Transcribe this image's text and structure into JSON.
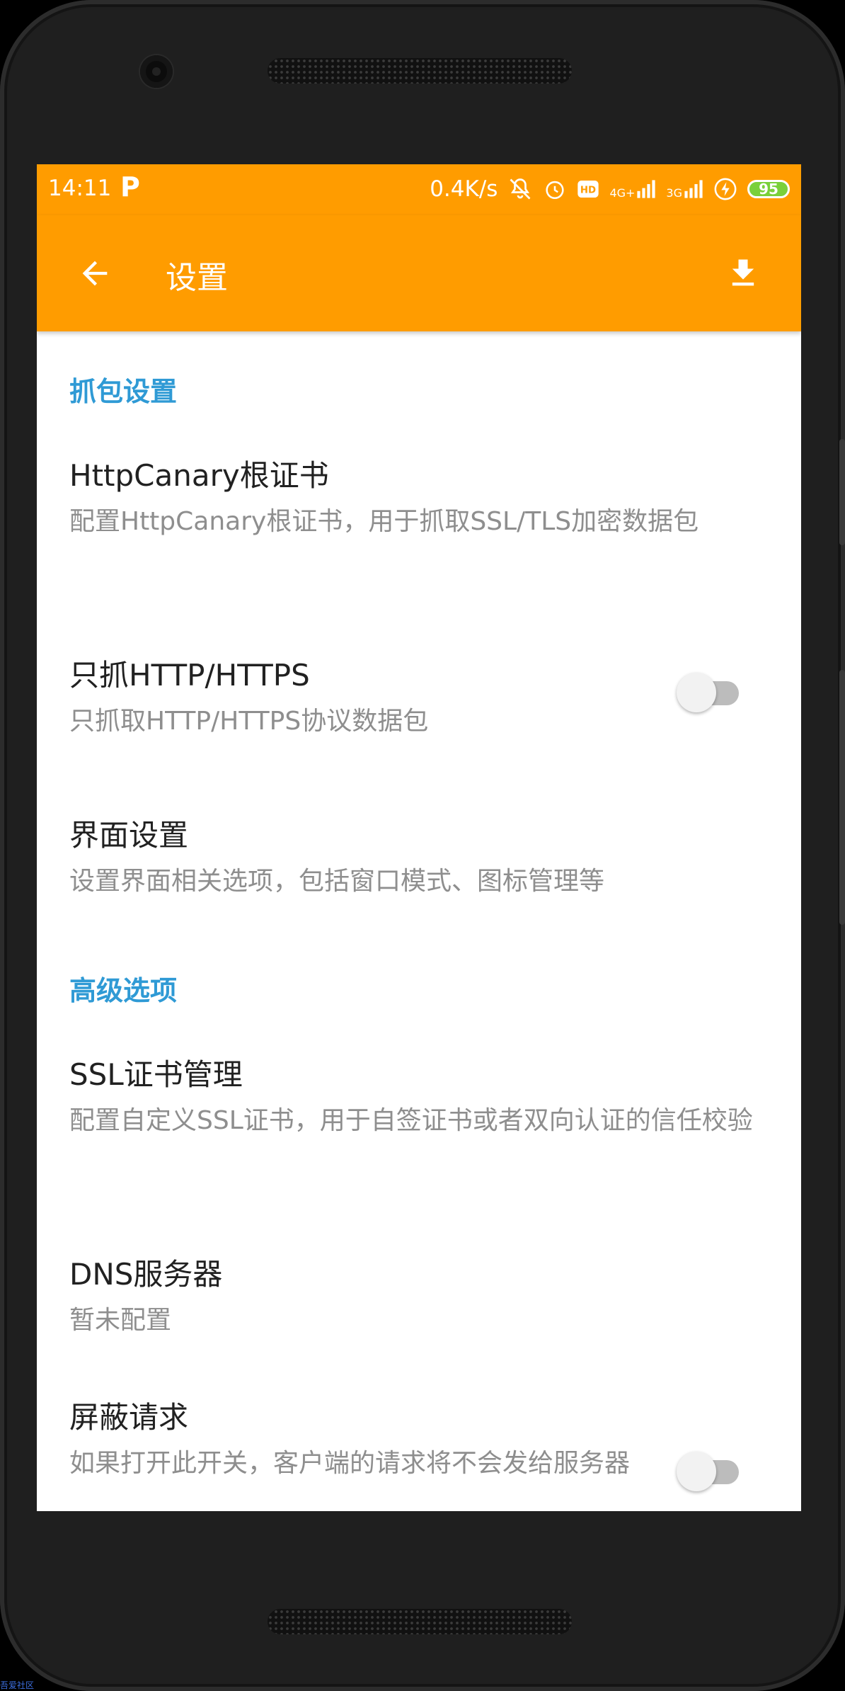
{
  "status_bar": {
    "time": "14:11",
    "p_indicator": "P",
    "net_speed": "0.4K/s",
    "signal_4g_label": "4G+",
    "signal_3g_label": "3G",
    "battery": "95",
    "icons": [
      "mute-bell-icon",
      "alarm-icon",
      "hd-icon",
      "signal-icon",
      "bolt-icon",
      "battery-icon"
    ]
  },
  "app_bar": {
    "title": "设置",
    "back_icon": "arrow-left-icon",
    "action_icon": "download-icon",
    "color": "#ff9c00"
  },
  "sections": [
    {
      "header": "抓包设置",
      "items": [
        {
          "title": "HttpCanary根证书",
          "summary": "配置HttpCanary根证书，用于抓取SSL/TLS加密数据包"
        },
        {
          "title": "只抓HTTP/HTTPS",
          "summary": "只抓取HTTP/HTTPS协议数据包",
          "switch": false
        },
        {
          "title": "界面设置",
          "summary": "设置界面相关选项，包括窗口模式、图标管理等"
        }
      ]
    },
    {
      "header": "高级选项",
      "items": [
        {
          "title": "SSL证书管理",
          "summary": "配置自定义SSL证书，用于自签证书或者双向认证的信任校验"
        },
        {
          "title": "DNS服务器",
          "summary": "暂未配置"
        },
        {
          "title": "屏蔽请求",
          "summary": "如果打开此开关，客户端的请求将不会发给服务器",
          "switch": false
        }
      ]
    }
  ],
  "colors": {
    "accent": "#2f9ad5",
    "primary": "#ff9c00"
  },
  "watermark": "吾爱社区"
}
